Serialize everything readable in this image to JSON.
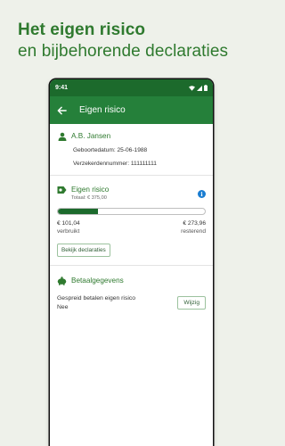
{
  "promo": {
    "title": "Het eigen risico",
    "subtitle": "en bijbehorende declaraties"
  },
  "status_bar": {
    "time": "9:41"
  },
  "app_bar": {
    "title": "Eigen risico"
  },
  "insured": {
    "name": "A.B. Jansen",
    "birthdate": "Geboortedatum: 25-06-1988",
    "insurance_number": "Verzekerdennummer: 111111111"
  },
  "deductible": {
    "title": "Eigen risico",
    "total": "Totaal: € 375,00",
    "used_fraction": 0.27,
    "used_amount": "€ 101,04",
    "used_label": "verbruikt",
    "remaining_amount": "€ 273,96",
    "remaining_label": "resterend",
    "claims_button": "Bekijk declaraties"
  },
  "payment": {
    "title": "Betaalgegevens",
    "label": "Gespreid betalen eigen risico",
    "value": "Nee",
    "edit_button": "Wijzig"
  },
  "colors": {
    "brand_green": "#25803a",
    "dark_green": "#1c6a2c",
    "text_green": "#2f7a2f",
    "info_blue": "#1a7dd1"
  }
}
